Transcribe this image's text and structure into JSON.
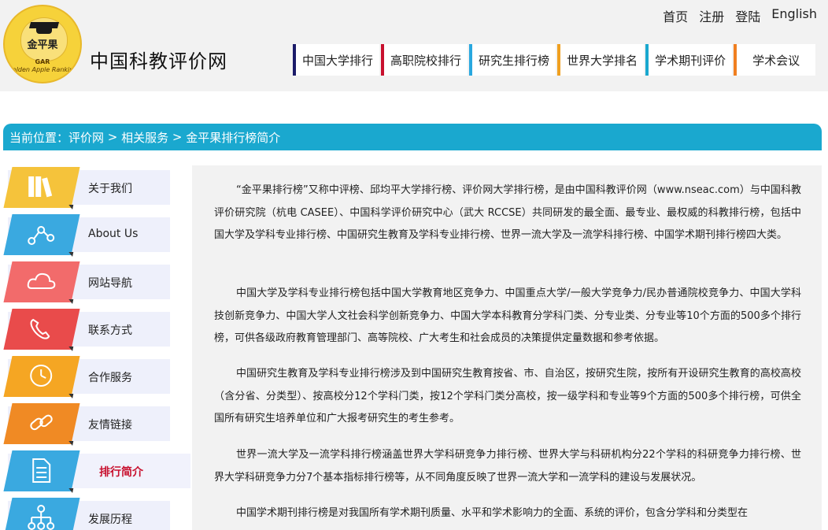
{
  "header": {
    "logo": {
      "mark": "金平果",
      "abbr": "GAR",
      "ring_text": "Golden Apple Ranking"
    },
    "site_title": "中国科教评价网",
    "top_links": [
      "首页",
      "注册",
      "登陆",
      "English"
    ],
    "nav": [
      {
        "label": "中国大学排行",
        "color": "#1c1c6a"
      },
      {
        "label": "高职院校排行",
        "color": "#c8102e"
      },
      {
        "label": "研究生排行榜",
        "color": "#29a8df"
      },
      {
        "label": "世界大学排名",
        "color": "#f0a020"
      },
      {
        "label": "学术期刊评价",
        "color": "#1aa8cf"
      },
      {
        "label": "学术会议",
        "color": "#f07f20"
      }
    ]
  },
  "breadcrumb": {
    "prefix": "当前位置：",
    "items": [
      "评价网",
      "相关服务",
      "金平果排行榜简介"
    ],
    "separator": " > "
  },
  "sidebar": {
    "items": [
      {
        "label": "关于我们",
        "icon": "books-icon",
        "color": "#f5c33b"
      },
      {
        "label": "About Us",
        "icon": "share-network-icon",
        "color": "#3aa9e0"
      },
      {
        "label": "网站导航",
        "icon": "cloud-icon",
        "color": "#f26b6b"
      },
      {
        "label": "联系方式",
        "icon": "phone-icon",
        "color": "#e94b4b"
      },
      {
        "label": "合作服务",
        "icon": "clock-icon",
        "color": "#f5a623"
      },
      {
        "label": "友情链接",
        "icon": "link-icon",
        "color": "#f08a24"
      },
      {
        "label": "排行简介",
        "icon": "document-icon",
        "color": "#3aa9e0",
        "active": true
      },
      {
        "label": "发展历程",
        "icon": "org-chart-icon",
        "color": "#3aa9e0"
      }
    ]
  },
  "content": {
    "paragraphs": [
      "“金平果排行榜”又称中评榜、邱均平大学排行榜、评价网大学排行榜，是由中国科教评价网（www.nseac.com）与中国科教评价研究院（杭电 CASEE）、中国科学评价研究中心（武大 RCCSE）共同研发的最全面、最专业、最权威的科教排行榜，包括中国大学及学科专业排行榜、中国研究生教育及学科专业排行榜、世界一流大学及一流学科排行榜、中国学术期刊排行榜四大类。",
      "中国大学及学科专业排行榜包括中国大学教育地区竞争力、中国重点大学/一般大学竞争力/民办普通院校竞争力、中国大学科技创新竞争力、中国大学人文社会科学创新竞争力、中国大学本科教育分学科门类、分专业类、分专业等10个方面的500多个排行榜，可供各级政府教育管理部门、高等院校、广大考生和社会成员的决策提供定量数据和参考依据。",
      "中国研究生教育及学科专业排行榜涉及到中国研究生教育按省、市、自治区，按研究生院，按所有开设研究生教育的高校高校（含分省、分类型）、按高校分12个学科门类，按12个学科门类分高校，按一级学科和专业等9个方面的500多个排行榜，可供全国所有研究生培养单位和广大报考研究生的考生参考。",
      "世界一流大学及一流学科排行榜涵盖世界大学科研竞争力排行榜、世界大学与科研机构分22个学科的科研竞争力排行榜、世界大学科研竞争力分7个基本指标排行榜等，从不同角度反映了世界一流大学和一流学科的建设与发展状况。",
      "中国学术期刊排行榜是对我国所有学术期刊质量、水平和学术影响力的全面、系统的评价，包含分学科和分类型在"
    ]
  }
}
